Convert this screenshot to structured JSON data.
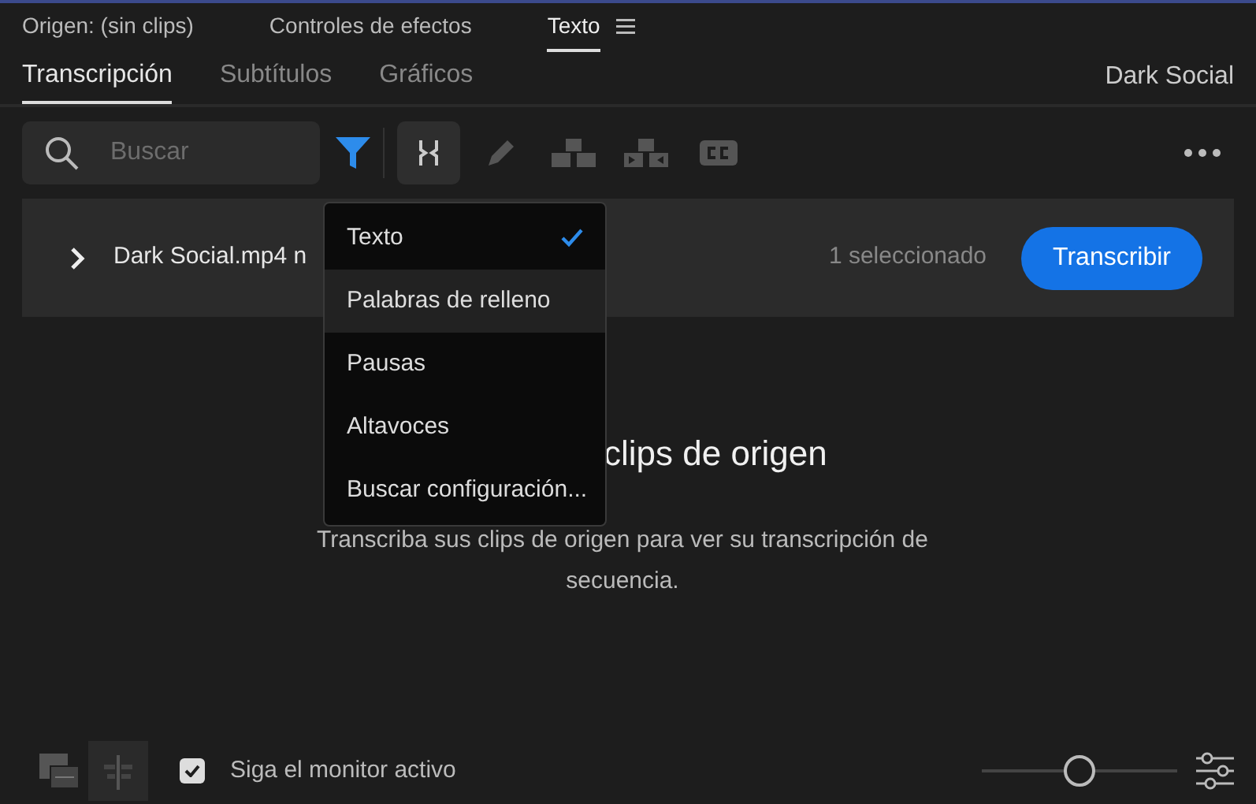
{
  "panel_tabs": [
    {
      "label": "Origen: (sin clips)",
      "selected": false
    },
    {
      "label": "Controles de efectos",
      "selected": false
    },
    {
      "label": "Texto",
      "selected": true
    }
  ],
  "subtabs": [
    {
      "label": "Transcripción",
      "selected": true
    },
    {
      "label": "Subtítulos",
      "selected": false
    },
    {
      "label": "Gráficos",
      "selected": false
    }
  ],
  "sequence_name": "Dark Social",
  "search": {
    "placeholder": "Buscar"
  },
  "filter": {
    "active": true
  },
  "tools": [
    {
      "kind": "split",
      "selected": true
    },
    {
      "kind": "pencil",
      "selected": false
    },
    {
      "kind": "merge",
      "selected": false
    },
    {
      "kind": "split-clip",
      "selected": false
    },
    {
      "kind": "captions",
      "selected": false
    }
  ],
  "clip": {
    "name": "Dark Social.mp4 n",
    "expanded": false,
    "count": "1 seleccionado",
    "button": "Transcribir"
  },
  "filter_menu": [
    {
      "label": "Texto",
      "checked": true,
      "highlighted": false
    },
    {
      "label": "Palabras de relleno",
      "checked": false,
      "highlighted": true
    },
    {
      "label": "Pausas",
      "checked": false,
      "highlighted": false
    },
    {
      "label": "Altavoces",
      "checked": false,
      "highlighted": false
    },
    {
      "label": "Buscar configuración...",
      "checked": false,
      "highlighted": false
    }
  ],
  "empty_state": {
    "heading": "clips de origen",
    "description": "Transcriba sus clips de origen para ver su transcripción de secuencia."
  },
  "footer": {
    "views": [
      {
        "kind": "source",
        "selected": false
      },
      {
        "kind": "sequence",
        "selected": true
      }
    ],
    "follow_monitor": {
      "label": "Siga el monitor activo",
      "checked": true
    },
    "zoom": {
      "level": 0.5
    }
  }
}
